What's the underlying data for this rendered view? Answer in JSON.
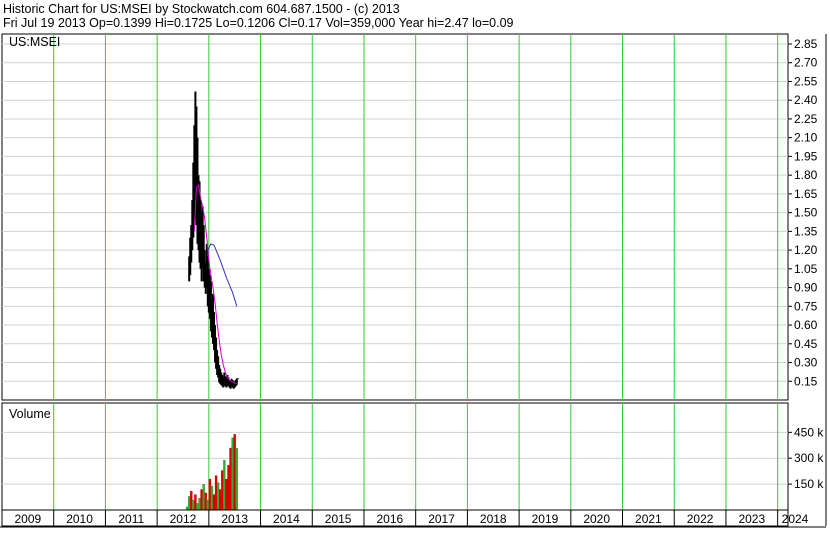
{
  "header": {
    "line1": "Historic Chart for US:MSEI by Stockwatch.com 604.687.1500 - (c) 2013",
    "line2": "Fri Jul 19 2013  Op=0.1399  Hi=0.1725  Lo=0.1206  Cl=0.17  Vol=359,000  Year hi=2.47  lo=0.09"
  },
  "colors": {
    "grid_vertical": "#33cc33",
    "grid_horizontal": "#d0d0d0",
    "price_bar": "#000000",
    "ma_short": "#cc00cc",
    "ma_long": "#3333cc",
    "volume_up": "#33aa33",
    "volume_down": "#dd0000"
  },
  "chart_data": [
    {
      "type": "line",
      "panel_label": "US:MSEI",
      "x_ticks": [
        "2009",
        "2010",
        "2011",
        "2012",
        "2013",
        "2014",
        "2015",
        "2016",
        "2017",
        "2018",
        "2019",
        "2020",
        "2021",
        "2022",
        "2023",
        "2024"
      ],
      "y_ticks": [
        "0.15",
        "0.30",
        "0.45",
        "0.60",
        "0.75",
        "0.90",
        "1.05",
        "1.20",
        "1.35",
        "1.50",
        "1.65",
        "1.80",
        "1.95",
        "2.10",
        "2.25",
        "2.40",
        "2.55",
        "2.70",
        "2.85"
      ],
      "ylim": [
        0,
        2.93
      ],
      "series": [
        {
          "x": [
            2012.62,
            2012.64,
            2012.66,
            2012.68,
            2012.7,
            2012.72,
            2012.74,
            2012.76,
            2012.78,
            2012.8,
            2012.82,
            2012.84,
            2012.86,
            2012.88,
            2012.9,
            2012.92,
            2012.94,
            2012.96,
            2012.98,
            2013.0,
            2013.02,
            2013.04,
            2013.06,
            2013.08,
            2013.1,
            2013.12,
            2013.14,
            2013.16,
            2013.18,
            2013.2,
            2013.22,
            2013.24,
            2013.26,
            2013.28,
            2013.3,
            2013.32,
            2013.34,
            2013.36,
            2013.38,
            2013.4,
            2013.42,
            2013.44,
            2013.46,
            2013.48,
            2013.5,
            2013.52,
            2013.54
          ],
          "high": [
            1.15,
            1.3,
            1.4,
            1.6,
            1.9,
            2.2,
            2.47,
            2.35,
            2.1,
            1.8,
            1.75,
            1.6,
            1.5,
            1.55,
            1.4,
            1.2,
            1.1,
            1.25,
            1.15,
            1.05,
            1.0,
            0.95,
            0.8,
            0.85,
            0.7,
            0.6,
            0.5,
            0.4,
            0.35,
            0.28,
            0.25,
            0.22,
            0.2,
            0.18,
            0.22,
            0.19,
            0.17,
            0.2,
            0.18,
            0.16,
            0.15,
            0.17,
            0.16,
            0.15,
            0.14,
            0.16,
            0.1725
          ],
          "low": [
            0.95,
            1.0,
            1.1,
            1.2,
            1.3,
            1.45,
            1.6,
            1.4,
            1.25,
            1.2,
            1.1,
            1.05,
            0.95,
            1.05,
            0.95,
            0.9,
            0.85,
            0.9,
            0.75,
            0.7,
            0.65,
            0.55,
            0.5,
            0.45,
            0.4,
            0.3,
            0.25,
            0.2,
            0.18,
            0.14,
            0.13,
            0.12,
            0.11,
            0.1,
            0.12,
            0.11,
            0.1,
            0.12,
            0.11,
            0.1,
            0.09,
            0.11,
            0.1,
            0.09,
            0.1,
            0.11,
            0.1206
          ],
          "close": [
            1.05,
            1.2,
            1.3,
            1.45,
            1.75,
            2.0,
            2.1,
            1.7,
            1.5,
            1.4,
            1.55,
            1.3,
            1.2,
            1.35,
            1.1,
            1.0,
            1.05,
            1.15,
            0.9,
            0.85,
            0.8,
            0.7,
            0.6,
            0.7,
            0.55,
            0.4,
            0.3,
            0.25,
            0.25,
            0.2,
            0.18,
            0.16,
            0.15,
            0.13,
            0.18,
            0.15,
            0.12,
            0.15,
            0.14,
            0.12,
            0.11,
            0.15,
            0.13,
            0.11,
            0.12,
            0.15,
            0.17
          ]
        },
        {
          "name": "",
          "color_key": "ma_short",
          "x": [
            2012.72,
            2012.76,
            2012.8,
            2012.84,
            2012.88,
            2012.92,
            2012.96,
            2013.0,
            2013.04,
            2013.08,
            2013.12,
            2013.16,
            2013.2,
            2013.24,
            2013.28,
            2013.32,
            2013.36,
            2013.4,
            2013.44,
            2013.48,
            2013.52,
            2013.54
          ],
          "y": [
            1.35,
            1.7,
            1.72,
            1.62,
            1.55,
            1.45,
            1.3,
            1.12,
            1.0,
            0.9,
            0.78,
            0.62,
            0.48,
            0.36,
            0.28,
            0.22,
            0.18,
            0.16,
            0.15,
            0.14,
            0.13,
            0.13
          ]
        },
        {
          "name": "",
          "color_key": "ma_long",
          "x": [
            2012.98,
            2013.04,
            2013.1,
            2013.16,
            2013.22,
            2013.28,
            2013.34,
            2013.4,
            2013.46,
            2013.52,
            2013.54
          ],
          "y": [
            1.2,
            1.25,
            1.24,
            1.18,
            1.12,
            1.05,
            0.98,
            0.92,
            0.86,
            0.78,
            0.75
          ]
        }
      ]
    },
    {
      "type": "bar",
      "panel_label": "Volume",
      "y_ticks": [
        "150 k",
        "300 k",
        "450 k"
      ],
      "y_tick_values": [
        150000,
        300000,
        450000
      ],
      "ylim": [
        0,
        620000
      ],
      "x": [
        2012.58,
        2012.62,
        2012.66,
        2012.7,
        2012.74,
        2012.78,
        2012.82,
        2012.86,
        2012.9,
        2012.94,
        2012.98,
        2013.02,
        2013.06,
        2013.1,
        2013.14,
        2013.18,
        2013.22,
        2013.26,
        2013.3,
        2013.34,
        2013.38,
        2013.42,
        2013.46,
        2013.5,
        2013.54
      ],
      "values": [
        20000,
        80000,
        110000,
        60000,
        90000,
        40000,
        70000,
        120000,
        150000,
        100000,
        60000,
        180000,
        140000,
        90000,
        200000,
        160000,
        120000,
        230000,
        290000,
        180000,
        260000,
        360000,
        420000,
        440000,
        359000
      ],
      "up": [
        true,
        true,
        false,
        true,
        false,
        true,
        true,
        false,
        true,
        false,
        true,
        false,
        true,
        false,
        false,
        true,
        false,
        false,
        true,
        false,
        false,
        false,
        true,
        false,
        true
      ]
    }
  ]
}
